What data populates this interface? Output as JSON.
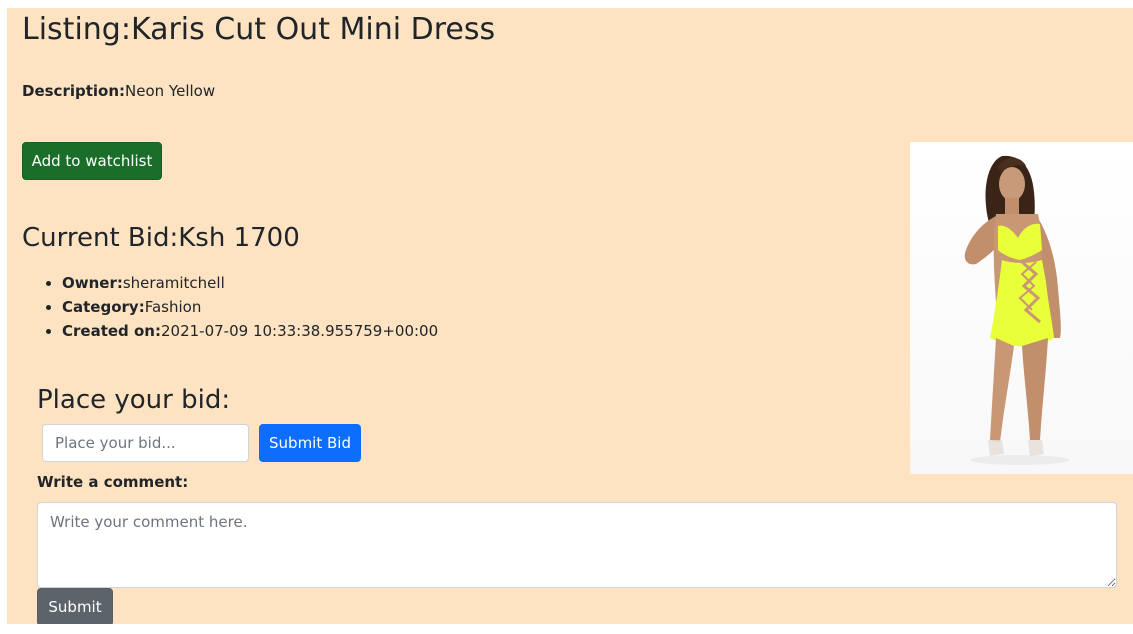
{
  "listing": {
    "title": "Listing:Karis Cut Out Mini Dress",
    "description_label": "Description:",
    "description_value": "Neon Yellow"
  },
  "actions": {
    "watchlist_label": "Add to watchlist"
  },
  "bid": {
    "current_bid_text": "Current Bid:Ksh 1700",
    "place_heading": "Place your bid:",
    "input_placeholder": "Place your bid...",
    "submit_label": "Submit Bid"
  },
  "details": [
    {
      "label": "Owner:",
      "value": "sheramitchell"
    },
    {
      "label": "Category:",
      "value": "Fashion"
    },
    {
      "label": "Created on:",
      "value": "2021-07-09 10:33:38.955759+00:00"
    }
  ],
  "comment": {
    "label": "Write a comment:",
    "placeholder": "Write your comment here.",
    "submit_label": "Submit"
  },
  "image": {
    "subject": "woman-in-neon-yellow-cutout-dress",
    "dress_color": "#e8ff3a"
  },
  "colors": {
    "page_background": "#fde3c2",
    "watchlist_button": "#1b6e2a",
    "bid_button": "#0d6efd",
    "submit_button": "#5c636a"
  }
}
